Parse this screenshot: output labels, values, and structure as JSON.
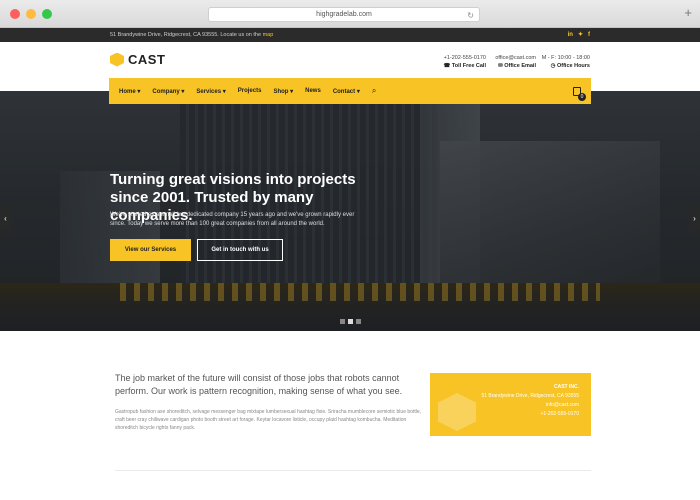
{
  "browser": {
    "url": "highgradelab.com"
  },
  "topbar": {
    "address_text": "51 Brandywine Drive, Ridgecrest, CA 93555. Locate us on the",
    "map_link": "map",
    "social": [
      "in",
      "t",
      "f"
    ]
  },
  "header": {
    "logo": "CAST",
    "phone": "+1-202-555-0170",
    "phone_label": "Toll Free Call",
    "email": "office@cast.com",
    "email_label": "Office Email",
    "hours": "M - F: 10:00 - 18:00",
    "hours_label": "Office Hours"
  },
  "nav": {
    "items": [
      "Home ▾",
      "Company ▾",
      "Services ▾",
      "Projects",
      "Shop ▾",
      "News",
      "Contact ▾"
    ],
    "cart_count": "0"
  },
  "hero": {
    "title": "Turning great visions into projects since 2001. Trusted by many companies.",
    "text": "We've started as a small but dedicated company 15 years ago and we've grown rapidly ever since. Today we serve more than 100 great companies from all around the world.",
    "primary_button": "View our Services",
    "secondary_button": "Get in touch with us"
  },
  "intro": {
    "lead": "The job market of the future will consist of those jobs that robots cannot perform. Our work is pattern recognition, making sense of what you see.",
    "body": "Gastropub fashion axe shoreditch, selvage messenger bag mixtape lumbersexual hashtag fixie. Sriracha mumblecore semiotic blue bottle, craft beer cray chillwave cardigan photo booth street art forage. Keytar locavore listicle, occupy plaid hashtag kombucha. Meditation shoreditch bicycle rights fanny pack."
  },
  "card": {
    "title": "CAST INC.",
    "address": "51 Brandywine Drive, Ridgecrest, CA 93555",
    "email": "info@cast.com",
    "phone": "+1-202-555-0170"
  },
  "colors": {
    "accent": "#f7c325",
    "dark": "#2b2b2b"
  }
}
